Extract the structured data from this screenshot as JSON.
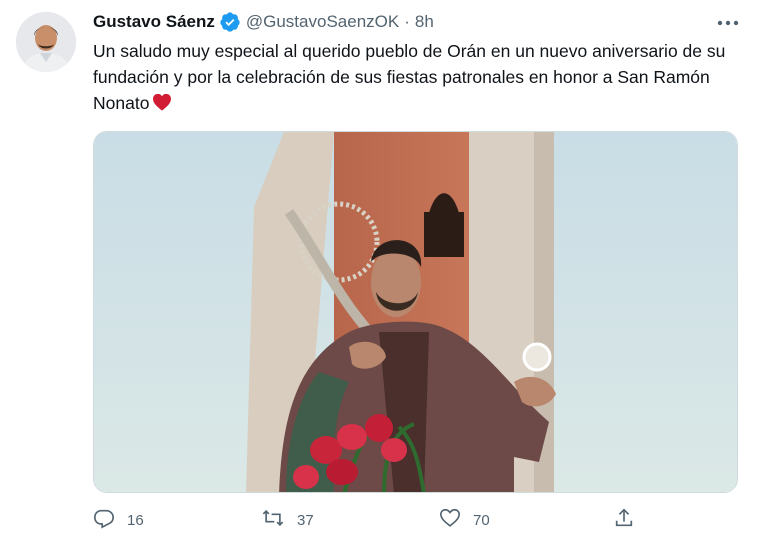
{
  "tweet": {
    "author": {
      "name": "Gustavo Sáenz",
      "handle": "@GustavoSaenzOK",
      "verified": true
    },
    "separator": "·",
    "time": "8h",
    "text": "Un saludo muy especial al querido pueblo de Orán en un nuevo aniversario de su fundación y por la celebración de sus fiestas patronales en honor a San Ramón Nonato",
    "emoji": "heart-emoji",
    "media_alt_subject": "statue-photo",
    "actions": {
      "reply_count": "16",
      "retweet_count": "37",
      "like_count": "70"
    },
    "colors": {
      "accent": "#1d9bf0",
      "secondary_text": "#536471",
      "heart": "#d21c35"
    }
  }
}
